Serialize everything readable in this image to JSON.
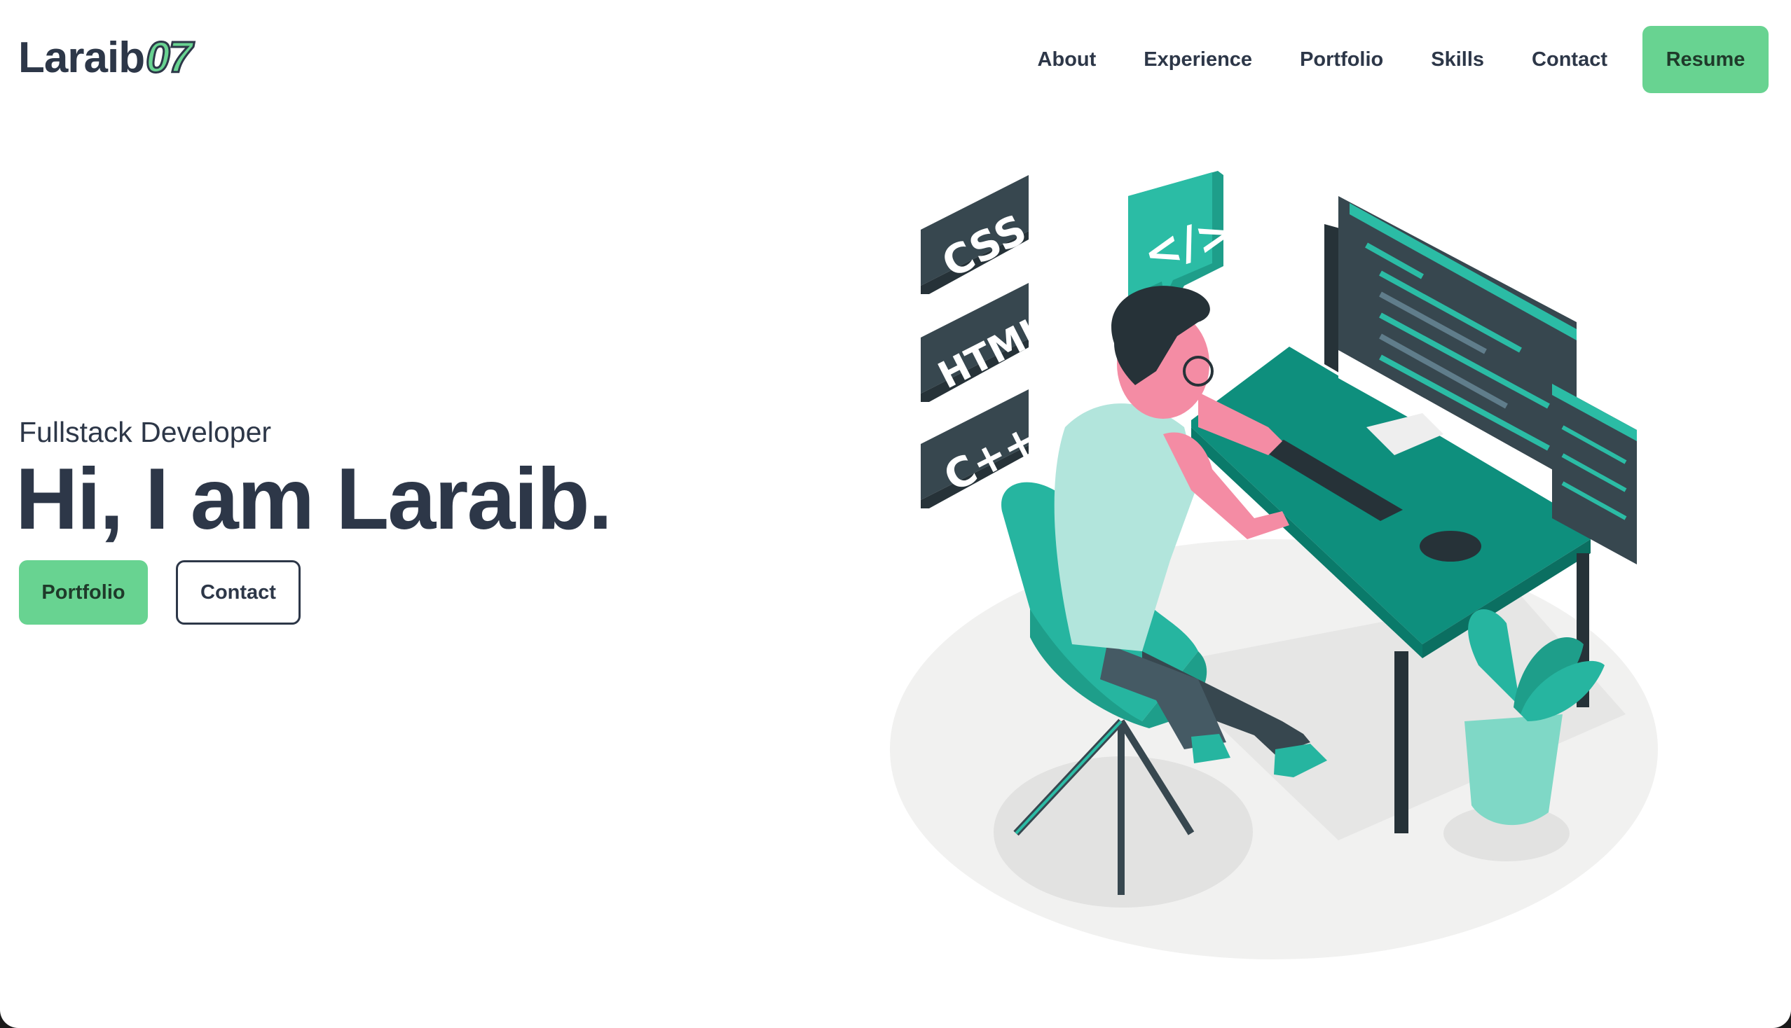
{
  "header": {
    "logo_text": "Laraib",
    "logo_accent": "07",
    "nav_items": [
      "About",
      "Experience",
      "Portfolio",
      "Skills",
      "Contact"
    ],
    "resume_label": "Resume"
  },
  "hero": {
    "subtitle": "Fullstack Developer",
    "title": "Hi, I am Laraib.",
    "buttons": [
      "Portfolio",
      "Contact"
    ]
  },
  "illustration": {
    "tiles": [
      "CSS",
      "HTML",
      "C++"
    ],
    "code_bubble": "</>"
  },
  "colors": {
    "accent": "#68d391",
    "text": "#2d3748",
    "teal": "#26b5a0",
    "dark_teal": "#0e8f7d",
    "dark": "#263238"
  }
}
